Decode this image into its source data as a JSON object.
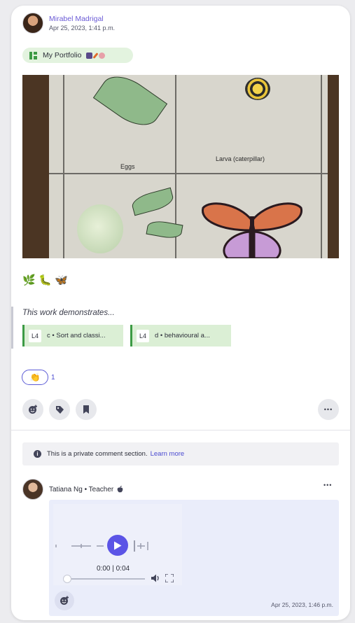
{
  "post": {
    "author_name": "Mirabel Madrigal",
    "date": "Apr 25, 2023, 1:41 p.m.",
    "folder": "My Portfolio",
    "emojis": [
      "🌿",
      "🐛",
      "🦋"
    ],
    "photo_labels": {
      "eggs": "Eggs",
      "larva": "Larva (caterpillar)"
    }
  },
  "demonstrates": {
    "title": "This work demonstrates...",
    "tags": [
      {
        "level": "L4",
        "text": "c • Sort and classi..."
      },
      {
        "level": "L4",
        "text": "d • behavioural a..."
      }
    ]
  },
  "reaction": {
    "emoji": "👏",
    "count": "1"
  },
  "actions": {
    "more": "•••"
  },
  "private_note": {
    "text": "This is a private comment section.",
    "link": "Learn more"
  },
  "comment": {
    "author": "Tatiana Ng • Teacher",
    "more": "•••",
    "audio_time": "0:00 | 0:04",
    "date": "Apr 25, 2023, 1:46 p.m."
  },
  "colors": {
    "accent": "#5b54e6",
    "green": "#3c9a44",
    "tag_bg": "#dbefd5"
  }
}
